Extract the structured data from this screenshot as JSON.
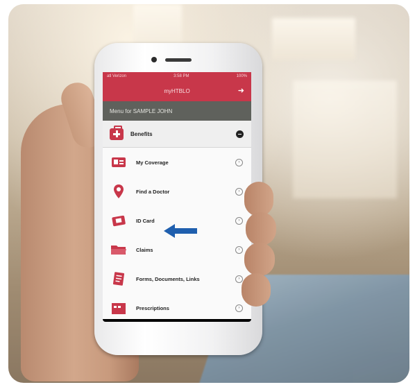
{
  "status_bar": {
    "carrier": "atl Verizon",
    "time": "3:58 PM",
    "battery": "100%"
  },
  "app_header": {
    "title": "myHTBLO",
    "logout_icon": "logout-arrow-icon"
  },
  "menu_band": {
    "text": "Menu for SAMPLE JOHN"
  },
  "benefits_section": {
    "label": "Benefits",
    "icon": "medical-kit-icon",
    "toggle_icon": "collapse-minus-icon"
  },
  "menu_items": [
    {
      "label": "My Coverage",
      "icon": "coverage-card-icon"
    },
    {
      "label": "Find a Doctor",
      "icon": "location-pin-icon"
    },
    {
      "label": "ID Card",
      "icon": "id-card-icon"
    },
    {
      "label": "Claims",
      "icon": "folder-icon"
    },
    {
      "label": "Forms, Documents, Links",
      "icon": "documents-icon"
    },
    {
      "label": "Prescriptions",
      "icon": "calendar-icon"
    }
  ],
  "colors": {
    "brand_red": "#c8374a",
    "band_gray": "#5f615c",
    "pointer_blue": "#1f5fae"
  }
}
